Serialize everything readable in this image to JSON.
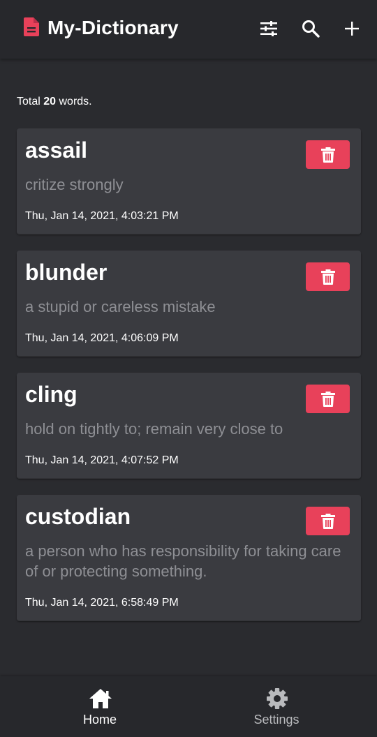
{
  "header": {
    "title": "My-Dictionary",
    "logo_icon": "document-icon",
    "actions": [
      {
        "icon": "sliders-icon"
      },
      {
        "icon": "search-icon"
      },
      {
        "icon": "plus-icon"
      }
    ]
  },
  "summary": {
    "prefix": "Total",
    "count": "20",
    "suffix": "words."
  },
  "words": [
    {
      "word": "assail",
      "meaning": "critize strongly",
      "date": "Thu, Jan 14, 2021, 4:03:21 PM"
    },
    {
      "word": "blunder",
      "meaning": "a stupid or careless mistake",
      "date": "Thu, Jan 14, 2021, 4:06:09 PM"
    },
    {
      "word": "cling",
      "meaning": "hold on tightly to; remain very close to",
      "date": "Thu, Jan 14, 2021, 4:07:52 PM"
    },
    {
      "word": "custodian",
      "meaning": "a person who has responsibility for taking care of or protecting something.",
      "date": "Thu, Jan 14, 2021, 6:58:49 PM"
    }
  ],
  "delete_icon": "trash-icon",
  "nav": {
    "home_label": "Home",
    "settings_label": "Settings",
    "home_icon": "home-icon",
    "settings_icon": "gear-icon",
    "active": "home"
  },
  "colors": {
    "background": "#2a2b2f",
    "card": "#3a3b40",
    "accent": "#e8415a",
    "muted_text": "#8e8f94"
  }
}
